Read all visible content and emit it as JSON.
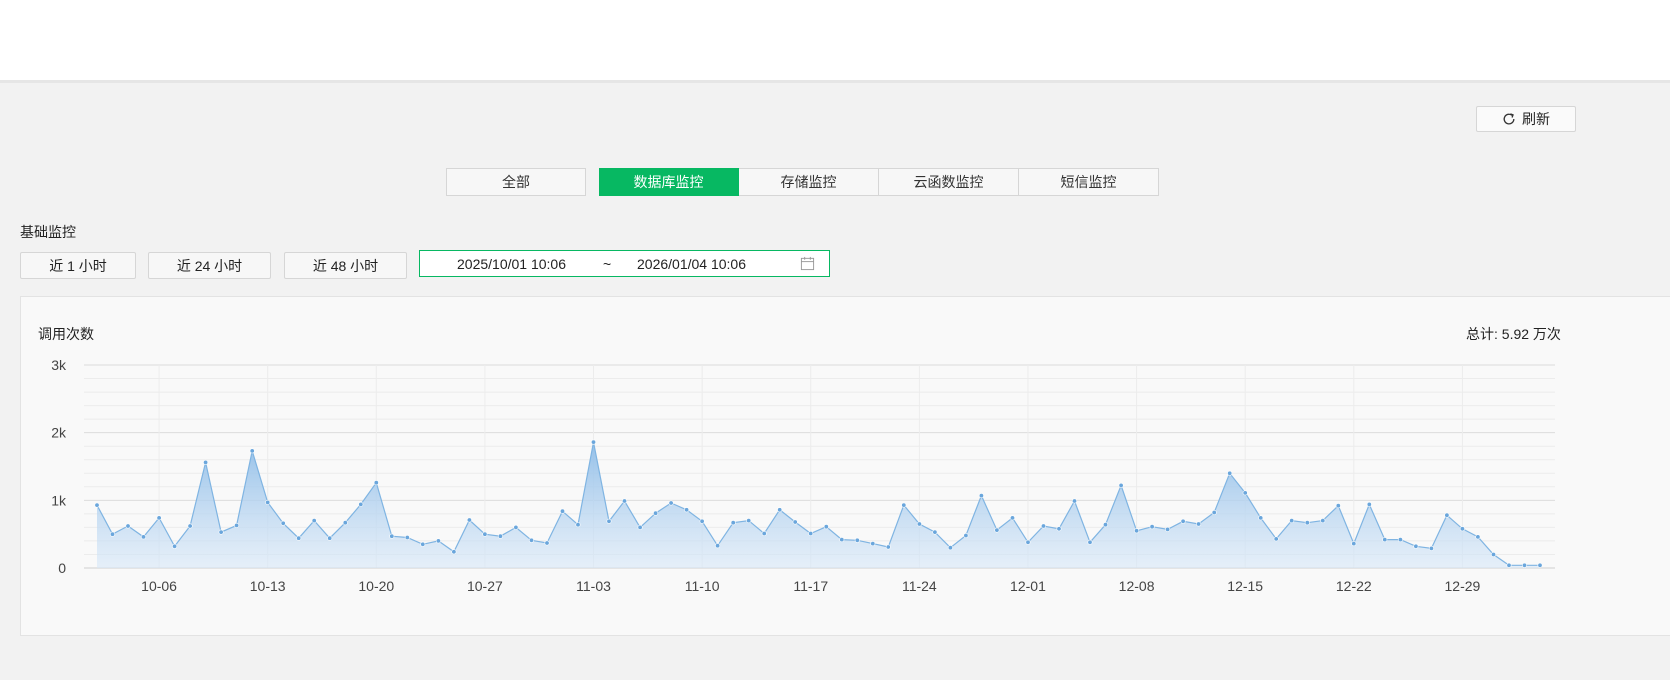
{
  "toolbar": {
    "refresh_label": "刷新"
  },
  "tabs": [
    {
      "label": "全部"
    },
    {
      "label": "数据库监控"
    },
    {
      "label": "存储监控"
    },
    {
      "label": "云函数监控"
    },
    {
      "label": "短信监控"
    }
  ],
  "active_tab": "数据库监控",
  "section_title": "基础监控",
  "range_buttons": [
    {
      "label": "近 1 小时"
    },
    {
      "label": "近 24 小时"
    },
    {
      "label": "近 48 小时"
    }
  ],
  "date_range": {
    "start": "2025/10/01 10:06",
    "separator": "~",
    "end": "2026/01/04 10:06"
  },
  "colors": {
    "accent": "#07b862",
    "series_line": "#7fb4e2",
    "area_top": "#a9cdf0"
  },
  "chart_data": {
    "type": "area",
    "title": "调用次数",
    "total_label": "总计: 5.92 万次",
    "y_ticks": [
      "3k",
      "2k",
      "1k",
      "0"
    ],
    "ylim": [
      0,
      3000
    ],
    "x_ticks": [
      "10-06",
      "10-13",
      "10-20",
      "10-27",
      "11-03",
      "11-10",
      "11-17",
      "11-24",
      "12-01",
      "12-08",
      "12-15",
      "12-22",
      "12-29"
    ],
    "x_tick_values": [
      5,
      12,
      19,
      26,
      33,
      40,
      47,
      54,
      61,
      68,
      75,
      82,
      89
    ],
    "grid": true,
    "x": [
      1,
      2,
      3,
      4,
      5,
      6,
      7,
      8,
      9,
      10,
      11,
      12,
      13,
      14,
      15,
      16,
      17,
      18,
      19,
      20,
      21,
      22,
      23,
      24,
      25,
      26,
      27,
      28,
      29,
      30,
      31,
      32,
      33,
      34,
      35,
      36,
      37,
      38,
      39,
      40,
      41,
      42,
      43,
      44,
      45,
      46,
      47,
      48,
      49,
      50,
      51,
      52,
      53,
      54,
      55,
      56,
      57,
      58,
      59,
      60,
      61,
      62,
      63,
      64,
      65,
      66,
      67,
      68,
      69,
      70,
      71,
      72,
      73,
      74,
      75,
      76,
      77,
      78,
      79,
      80,
      81,
      82,
      83,
      84,
      85,
      86,
      87,
      88,
      89,
      90,
      91,
      92,
      93,
      94
    ],
    "values": [
      930,
      500,
      620,
      460,
      740,
      320,
      620,
      1560,
      530,
      630,
      1730,
      970,
      660,
      440,
      700,
      440,
      670,
      940,
      1260,
      470,
      450,
      350,
      400,
      240,
      710,
      500,
      470,
      600,
      410,
      370,
      840,
      640,
      1860,
      690,
      990,
      600,
      810,
      960,
      860,
      690,
      330,
      670,
      700,
      510,
      860,
      680,
      510,
      610,
      420,
      410,
      360,
      310,
      930,
      650,
      530,
      300,
      480,
      1070,
      560,
      740,
      380,
      620,
      580,
      990,
      380,
      640,
      1220,
      550,
      610,
      570,
      690,
      650,
      820,
      1400,
      1110,
      740,
      430,
      700,
      670,
      700,
      920,
      360,
      940,
      420,
      420,
      320,
      290,
      780,
      580,
      460,
      200,
      40,
      40,
      40
    ]
  }
}
